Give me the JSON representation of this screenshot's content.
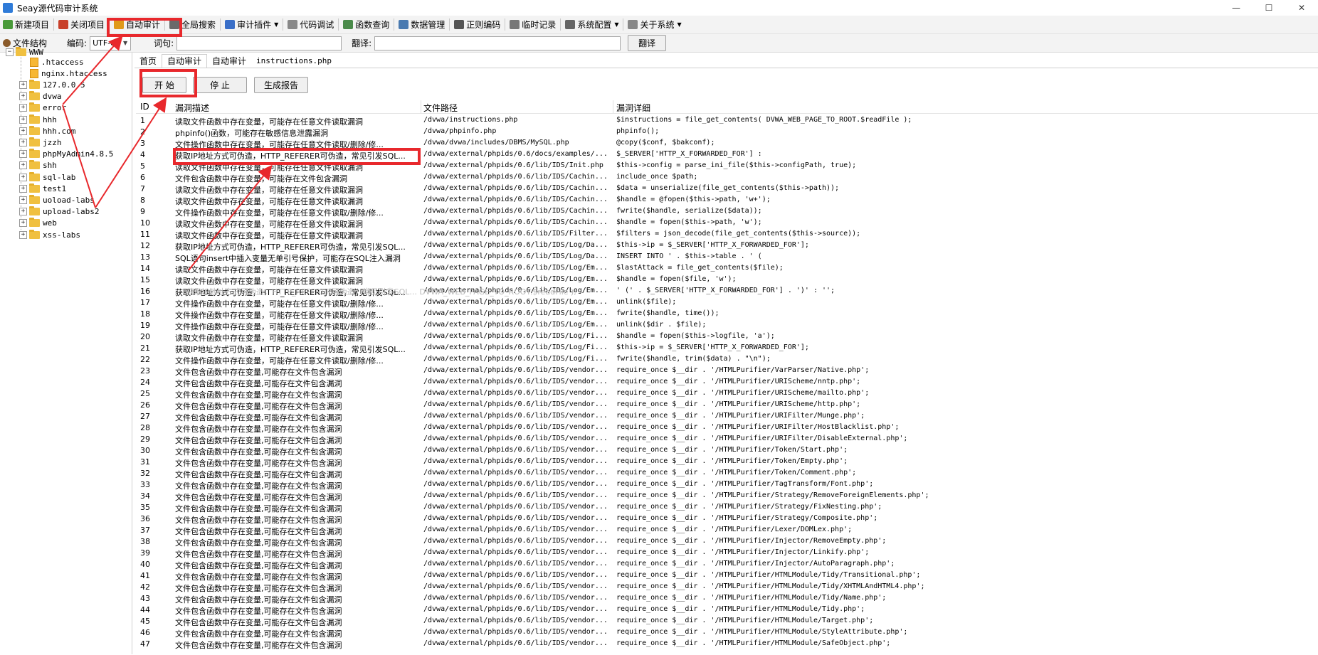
{
  "window": {
    "title": "Seay源代码审计系统",
    "controls": {
      "minimize": "—",
      "maximize": "☐",
      "close": "✕"
    }
  },
  "toolbar": {
    "items": [
      {
        "label": "新建项目",
        "icon": "new-project-icon",
        "color": "#4a9a3a"
      },
      {
        "label": "关闭项目",
        "icon": "close-project-icon",
        "color": "#c8402a"
      },
      {
        "label": "自动审计",
        "icon": "auto-audit-icon",
        "color": "#e09a1a"
      },
      {
        "label": "全局搜索",
        "icon": "search-icon",
        "color": "#6a6a6a"
      },
      {
        "label": "审计插件",
        "icon": "plugin-icon",
        "color": "#3a6fc8",
        "dropdown": true
      },
      {
        "label": "代码调试",
        "icon": "debug-icon",
        "color": "#888888"
      },
      {
        "label": "函数查询",
        "icon": "function-query-icon",
        "color": "#4a8a4a"
      },
      {
        "label": "数据管理",
        "icon": "data-manage-icon",
        "color": "#4a7ab0"
      },
      {
        "label": "正则编码",
        "icon": "regex-encode-icon",
        "color": "#555555"
      },
      {
        "label": "临时记录",
        "icon": "temp-record-icon",
        "color": "#777777"
      },
      {
        "label": "系统配置",
        "icon": "gear-icon",
        "color": "#666666",
        "dropdown": true
      },
      {
        "label": "关于系统",
        "icon": "about-icon",
        "color": "#888888",
        "dropdown": true
      }
    ]
  },
  "toolbar2": {
    "file_structure": "文件结构",
    "encoding_label": "编码:",
    "encoding_value": "UTF-8",
    "word_label": "词句:",
    "translate_label": "翻译:",
    "translate_button": "翻译"
  },
  "tree": {
    "root": "WWW",
    "items": [
      {
        "name": ".htaccess",
        "type": "file"
      },
      {
        "name": "nginx.htaccess",
        "type": "file"
      },
      {
        "name": "127.0.0.5",
        "type": "folder"
      },
      {
        "name": "dvwa",
        "type": "folder"
      },
      {
        "name": "error",
        "type": "folder"
      },
      {
        "name": "hhh",
        "type": "folder"
      },
      {
        "name": "hhh.com",
        "type": "folder"
      },
      {
        "name": "jzzh",
        "type": "folder"
      },
      {
        "name": "phpMyAdmin4.8.5",
        "type": "folder"
      },
      {
        "name": "shh",
        "type": "folder"
      },
      {
        "name": "sql-lab",
        "type": "folder"
      },
      {
        "name": "test1",
        "type": "folder"
      },
      {
        "name": "uoload-labs",
        "type": "folder"
      },
      {
        "name": "upload-labs2",
        "type": "folder"
      },
      {
        "name": "web",
        "type": "folder"
      },
      {
        "name": "xss-labs",
        "type": "folder"
      }
    ]
  },
  "tabs": [
    "首页",
    "自动审计",
    "自动审计",
    "instructions.php"
  ],
  "audit": {
    "start_button": "开 始",
    "stop_button": "停 止",
    "report_button": "生成报告"
  },
  "table": {
    "headers": {
      "id": "ID",
      "desc": "漏洞描述",
      "path": "文件路径",
      "detail": "漏洞详细"
    },
    "rows": [
      {
        "id": "1",
        "desc": "读取文件函数中存在变量，可能存在任意文件读取漏洞",
        "path": "/dvwa/instructions.php",
        "detail": "$instructions = file_get_contents( DVWA_WEB_PAGE_TO_ROOT.$readFile );"
      },
      {
        "id": "2",
        "desc": "phpinfo()函数，可能存在敏感信息泄露漏洞",
        "path": "/dvwa/phpinfo.php",
        "detail": "phpinfo();"
      },
      {
        "id": "3",
        "desc": "文件操作函数中存在变量，可能存在任意文件读取/删除/修...",
        "path": "/dvwa/dvwa/includes/DBMS/MySQL.php",
        "detail": "@copy($conf, $bakconf);"
      },
      {
        "id": "4",
        "desc": "获取IP地址方式可伪造，HTTP_REFERER可伪造，常见引发SQL...",
        "path": "/dvwa/external/phpids/0.6/docs/examples/...",
        "detail": "$_SERVER['HTTP_X_FORWARDED_FOR'] :"
      },
      {
        "id": "5",
        "desc": "读取文件函数中存在变量，可能存在任意文件读取漏洞",
        "path": "/dvwa/external/phpids/0.6/lib/IDS/Init.php",
        "detail": "$this->config = parse_ini_file($this->configPath, true);"
      },
      {
        "id": "6",
        "desc": "文件包含函数中存在变量，可能存在文件包含漏洞",
        "path": "/dvwa/external/phpids/0.6/lib/IDS/Cachin...",
        "detail": "include_once $path;"
      },
      {
        "id": "7",
        "desc": "读取文件函数中存在变量，可能存在任意文件读取漏洞",
        "path": "/dvwa/external/phpids/0.6/lib/IDS/Cachin...",
        "detail": "$data = unserialize(file_get_contents($this->path));"
      },
      {
        "id": "8",
        "desc": "读取文件函数中存在变量，可能存在任意文件读取漏洞",
        "path": "/dvwa/external/phpids/0.6/lib/IDS/Cachin...",
        "detail": "$handle = @fopen($this->path, 'w+');"
      },
      {
        "id": "9",
        "desc": "文件操作函数中存在变量，可能存在任意文件读取/删除/修...",
        "path": "/dvwa/external/phpids/0.6/lib/IDS/Cachin...",
        "detail": "fwrite($handle, serialize($data));"
      },
      {
        "id": "10",
        "desc": "读取文件函数中存在变量，可能存在任意文件读取漏洞",
        "path": "/dvwa/external/phpids/0.6/lib/IDS/Cachin...",
        "detail": "$handle = fopen($this->path, 'w');"
      },
      {
        "id": "11",
        "desc": "读取文件函数中存在变量，可能存在任意文件读取漏洞",
        "path": "/dvwa/external/phpids/0.6/lib/IDS/Filter...",
        "detail": "$filters = json_decode(file_get_contents($this->source));"
      },
      {
        "id": "12",
        "desc": "获取IP地址方式可伪造，HTTP_REFERER可伪造，常见引发SQL...",
        "path": "/dvwa/external/phpids/0.6/lib/IDS/Log/Da...",
        "detail": "$this->ip = $_SERVER['HTTP_X_FORWARDED_FOR'];"
      },
      {
        "id": "13",
        "desc": "SQL语句insert中插入变量无单引号保护，可能存在SQL注入漏洞",
        "path": "/dvwa/external/phpids/0.6/lib/IDS/Log/Da...",
        "detail": "INSERT INTO ' . $this->table . ' ("
      },
      {
        "id": "14",
        "desc": "读取文件函数中存在变量，可能存在任意文件读取漏洞",
        "path": "/dvwa/external/phpids/0.6/lib/IDS/Log/Em...",
        "detail": "$lastAttack = file_get_contents($file);"
      },
      {
        "id": "15",
        "desc": "读取文件函数中存在变量，可能存在任意文件读取漏洞",
        "path": "/dvwa/external/phpids/0.6/lib/IDS/Log/Em...",
        "detail": "$handle = fopen($file, 'w');"
      },
      {
        "id": "16",
        "desc": "获取IP地址方式可伪造，HTTP_REFERER可伪造，常见引发SQL...",
        "path": "/dvwa/external/phpids/0.6/lib/IDS/Log/Em...",
        "detail": "' (' . $_SERVER['HTTP_X_FORWARDED_FOR'] . ')' : '';"
      },
      {
        "id": "17",
        "desc": "文件操作函数中存在变量，可能存在任意文件读取/删除/修...",
        "path": "/dvwa/external/phpids/0.6/lib/IDS/Log/Em...",
        "detail": "unlink($file);"
      },
      {
        "id": "18",
        "desc": "文件操作函数中存在变量，可能存在任意文件读取/删除/修...",
        "path": "/dvwa/external/phpids/0.6/lib/IDS/Log/Em...",
        "detail": "fwrite($handle, time());"
      },
      {
        "id": "19",
        "desc": "文件操作函数中存在变量，可能存在任意文件读取/删除/修...",
        "path": "/dvwa/external/phpids/0.6/lib/IDS/Log/Em...",
        "detail": "unlink($dir . $file);"
      },
      {
        "id": "20",
        "desc": "读取文件函数中存在变量，可能存在任意文件读取漏洞",
        "path": "/dvwa/external/phpids/0.6/lib/IDS/Log/Fi...",
        "detail": "$handle = fopen($this->logfile, 'a');"
      },
      {
        "id": "21",
        "desc": "获取IP地址方式可伪造，HTTP_REFERER可伪造，常见引发SQL...",
        "path": "/dvwa/external/phpids/0.6/lib/IDS/Log/Fi...",
        "detail": "$this->ip = $_SERVER['HTTP_X_FORWARDED_FOR'];"
      },
      {
        "id": "22",
        "desc": "文件操作函数中存在变量，可能存在任意文件读取/删除/修...",
        "path": "/dvwa/external/phpids/0.6/lib/IDS/Log/Fi...",
        "detail": "fwrite($handle, trim($data) . \"\\n\");"
      },
      {
        "id": "23",
        "desc": "文件包含函数中存在变量,可能存在文件包含漏洞",
        "path": "/dvwa/external/phpids/0.6/lib/IDS/vendor...",
        "detail": "require_once $__dir . '/HTMLPurifier/VarParser/Native.php';"
      },
      {
        "id": "24",
        "desc": "文件包含函数中存在变量,可能存在文件包含漏洞",
        "path": "/dvwa/external/phpids/0.6/lib/IDS/vendor...",
        "detail": "require_once $__dir . '/HTMLPurifier/URIScheme/nntp.php';"
      },
      {
        "id": "25",
        "desc": "文件包含函数中存在变量,可能存在文件包含漏洞",
        "path": "/dvwa/external/phpids/0.6/lib/IDS/vendor...",
        "detail": "require_once $__dir . '/HTMLPurifier/URIScheme/mailto.php';"
      },
      {
        "id": "26",
        "desc": "文件包含函数中存在变量,可能存在文件包含漏洞",
        "path": "/dvwa/external/phpids/0.6/lib/IDS/vendor...",
        "detail": "require_once $__dir . '/HTMLPurifier/URIScheme/http.php';"
      },
      {
        "id": "27",
        "desc": "文件包含函数中存在变量,可能存在文件包含漏洞",
        "path": "/dvwa/external/phpids/0.6/lib/IDS/vendor...",
        "detail": "require_once $__dir . '/HTMLPurifier/URIFilter/Munge.php';"
      },
      {
        "id": "28",
        "desc": "文件包含函数中存在变量,可能存在文件包含漏洞",
        "path": "/dvwa/external/phpids/0.6/lib/IDS/vendor...",
        "detail": "require_once $__dir . '/HTMLPurifier/URIFilter/HostBlacklist.php';"
      },
      {
        "id": "29",
        "desc": "文件包含函数中存在变量,可能存在文件包含漏洞",
        "path": "/dvwa/external/phpids/0.6/lib/IDS/vendor...",
        "detail": "require_once $__dir . '/HTMLPurifier/URIFilter/DisableExternal.php';"
      },
      {
        "id": "30",
        "desc": "文件包含函数中存在变量,可能存在文件包含漏洞",
        "path": "/dvwa/external/phpids/0.6/lib/IDS/vendor...",
        "detail": "require_once $__dir . '/HTMLPurifier/Token/Start.php';"
      },
      {
        "id": "31",
        "desc": "文件包含函数中存在变量,可能存在文件包含漏洞",
        "path": "/dvwa/external/phpids/0.6/lib/IDS/vendor...",
        "detail": "require_once $__dir . '/HTMLPurifier/Token/Empty.php';"
      },
      {
        "id": "32",
        "desc": "文件包含函数中存在变量,可能存在文件包含漏洞",
        "path": "/dvwa/external/phpids/0.6/lib/IDS/vendor...",
        "detail": "require_once $__dir . '/HTMLPurifier/Token/Comment.php';"
      },
      {
        "id": "33",
        "desc": "文件包含函数中存在变量,可能存在文件包含漏洞",
        "path": "/dvwa/external/phpids/0.6/lib/IDS/vendor...",
        "detail": "require_once $__dir . '/HTMLPurifier/TagTransform/Font.php';"
      },
      {
        "id": "34",
        "desc": "文件包含函数中存在变量,可能存在文件包含漏洞",
        "path": "/dvwa/external/phpids/0.6/lib/IDS/vendor...",
        "detail": "require_once $__dir . '/HTMLPurifier/Strategy/RemoveForeignElements.php';"
      },
      {
        "id": "35",
        "desc": "文件包含函数中存在变量,可能存在文件包含漏洞",
        "path": "/dvwa/external/phpids/0.6/lib/IDS/vendor...",
        "detail": "require_once $__dir . '/HTMLPurifier/Strategy/FixNesting.php';"
      },
      {
        "id": "36",
        "desc": "文件包含函数中存在变量,可能存在文件包含漏洞",
        "path": "/dvwa/external/phpids/0.6/lib/IDS/vendor...",
        "detail": "require_once $__dir . '/HTMLPurifier/Strategy/Composite.php';"
      },
      {
        "id": "37",
        "desc": "文件包含函数中存在变量,可能存在文件包含漏洞",
        "path": "/dvwa/external/phpids/0.6/lib/IDS/vendor...",
        "detail": "require_once $__dir . '/HTMLPurifier/Lexer/DOMLex.php';"
      },
      {
        "id": "38",
        "desc": "文件包含函数中存在变量,可能存在文件包含漏洞",
        "path": "/dvwa/external/phpids/0.6/lib/IDS/vendor...",
        "detail": "require_once $__dir . '/HTMLPurifier/Injector/RemoveEmpty.php';"
      },
      {
        "id": "39",
        "desc": "文件包含函数中存在变量,可能存在文件包含漏洞",
        "path": "/dvwa/external/phpids/0.6/lib/IDS/vendor...",
        "detail": "require_once $__dir . '/HTMLPurifier/Injector/Linkify.php';"
      },
      {
        "id": "40",
        "desc": "文件包含函数中存在变量,可能存在文件包含漏洞",
        "path": "/dvwa/external/phpids/0.6/lib/IDS/vendor...",
        "detail": "require_once $__dir . '/HTMLPurifier/Injector/AutoParagraph.php';"
      },
      {
        "id": "41",
        "desc": "文件包含函数中存在变量,可能存在文件包含漏洞",
        "path": "/dvwa/external/phpids/0.6/lib/IDS/vendor...",
        "detail": "require_once $__dir . '/HTMLPurifier/HTMLModule/Tidy/Transitional.php';"
      },
      {
        "id": "42",
        "desc": "文件包含函数中存在变量,可能存在文件包含漏洞",
        "path": "/dvwa/external/phpids/0.6/lib/IDS/vendor...",
        "detail": "require_once $__dir . '/HTMLPurifier/HTMLModule/Tidy/XHTMLAndHTML4.php';"
      },
      {
        "id": "43",
        "desc": "文件包含函数中存在变量,可能存在文件包含漏洞",
        "path": "/dvwa/external/phpids/0.6/lib/IDS/vendor...",
        "detail": "require_once $__dir . '/HTMLPurifier/HTMLModule/Tidy/Name.php';"
      },
      {
        "id": "44",
        "desc": "文件包含函数中存在变量,可能存在文件包含漏洞",
        "path": "/dvwa/external/phpids/0.6/lib/IDS/vendor...",
        "detail": "require_once $__dir . '/HTMLPurifier/HTMLModule/Tidy.php';"
      },
      {
        "id": "45",
        "desc": "文件包含函数中存在变量,可能存在文件包含漏洞",
        "path": "/dvwa/external/phpids/0.6/lib/IDS/vendor...",
        "detail": "require_once $__dir . '/HTMLPurifier/HTMLModule/Target.php';"
      },
      {
        "id": "46",
        "desc": "文件包含函数中存在变量,可能存在文件包含漏洞",
        "path": "/dvwa/external/phpids/0.6/lib/IDS/vendor...",
        "detail": "require_once $__dir . '/HTMLPurifier/HTMLModule/StyleAttribute.php';"
      },
      {
        "id": "47",
        "desc": "文件包含函数中存在变量,可能存在文件包含漏洞",
        "path": "/dvwa/external/phpids/0.6/lib/IDS/vendor...",
        "detail": "require_once $__dir . '/HTMLPurifier/HTMLModule/SafeObject.php';"
      }
    ],
    "ghost_overlay": "获取IP地址方式可伪造，HTTP_REFERER可伪造，常见引发SQL... DVWA_WEB_PAGE_TO_ROOT.$readFile );"
  },
  "annotation_color": "#e8282c"
}
